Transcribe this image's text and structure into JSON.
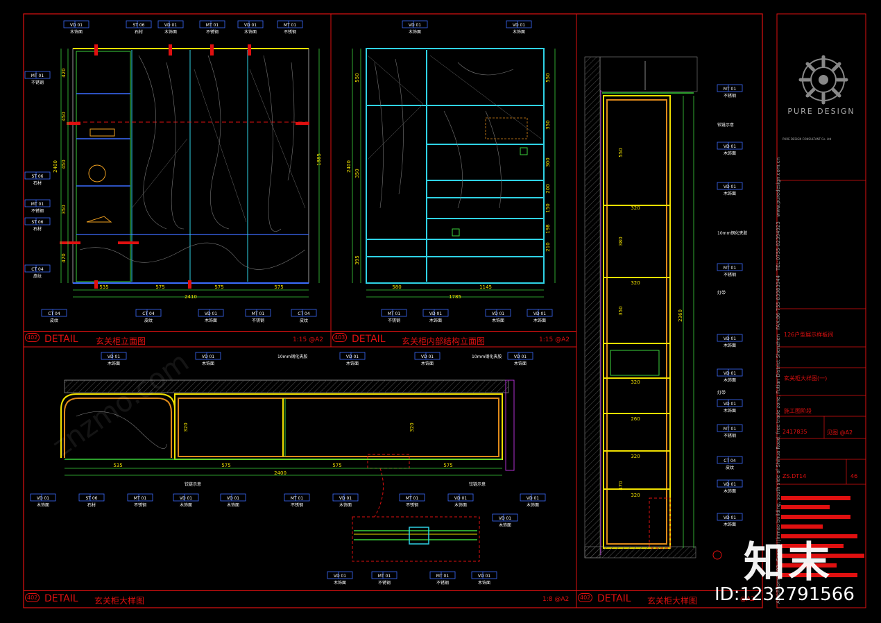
{
  "panels": {
    "p1": {
      "label": "DETAIL",
      "title": "玄关柜立面图",
      "scale": "1:15 @A2",
      "num": "402"
    },
    "p2": {
      "label": "DETAIL",
      "title": "玄关柜内部结构立面图",
      "scale": "1:15 @A2",
      "num": "403"
    },
    "p3": {
      "label": "DETAIL",
      "title": "玄关柜大样图",
      "scale": "1:8 @A2",
      "num": "402"
    },
    "p4": {
      "label": "DETAIL",
      "title": "玄关柜大样图",
      "scale": "@A2",
      "num": "402"
    }
  },
  "tags": {
    "vd": "VD 01",
    "st": "ST 06",
    "mt": "MT 01",
    "ct": "CT 04",
    "vd_note": "木饰面",
    "st_note": "石材",
    "mt_note": "不锈钢",
    "ct_note": "皮纹"
  },
  "dims": {
    "p1_bottom": [
      "535",
      "575",
      "575",
      "575"
    ],
    "p1_total": "2410",
    "p1_left": [
      "420",
      "450",
      "450",
      "350",
      "470"
    ],
    "p1_height": "2400",
    "p1_right": "1885",
    "p2_bottom": [
      "580",
      "1145"
    ],
    "p2_total": "1785",
    "p2_left": [
      "550",
      "350",
      "395"
    ],
    "p2_height": "2400",
    "p2_right": [
      "550",
      "350",
      "300",
      "200",
      "150",
      "198",
      "210"
    ],
    "p3_bottom": [
      "535",
      "575",
      "575",
      "575"
    ],
    "p3_total": "2400",
    "p3_depth": "320",
    "p4_widths": [
      "320",
      "320",
      "320",
      "260",
      "320",
      "320"
    ],
    "p4_heights": [
      "550",
      "380",
      "350",
      "470"
    ],
    "p4_total": "2360"
  },
  "notes": {
    "glass": "10mm钢化夹胶",
    "led": "灯带",
    "hinge": "铰链示意"
  },
  "title_block": {
    "brand": "PURE DESIGN",
    "company_line": "PURE DESIGN CONSULTANT Co. Ltd",
    "tel": "TEL:0755-82394923",
    "fax": "FAX:86-755-83983944",
    "address": "Add:Room 3303, Caoshui Jinmao building, south side of Shihua Road, free trade zone, Futian District Shenzhen",
    "project": "126户型展示样板间",
    "drawing_name": "玄关柜大样图(一)",
    "stage": "施工图阶段",
    "project_no": "2417835",
    "scale": "见图 @A2",
    "drawing_no": "ZS.DT14",
    "page": "46",
    "website": "www.puredesign.com.cn"
  },
  "watermark": {
    "logo": "知末",
    "id": "ID:1232791566",
    "url": "znzmo.com"
  },
  "colors": {
    "border": "#e01010",
    "cyan": "#2fd3e6",
    "blue": "#3c6cff",
    "yellow": "#f0e000",
    "green": "#3bd23b",
    "orange": "#e08a1a"
  }
}
